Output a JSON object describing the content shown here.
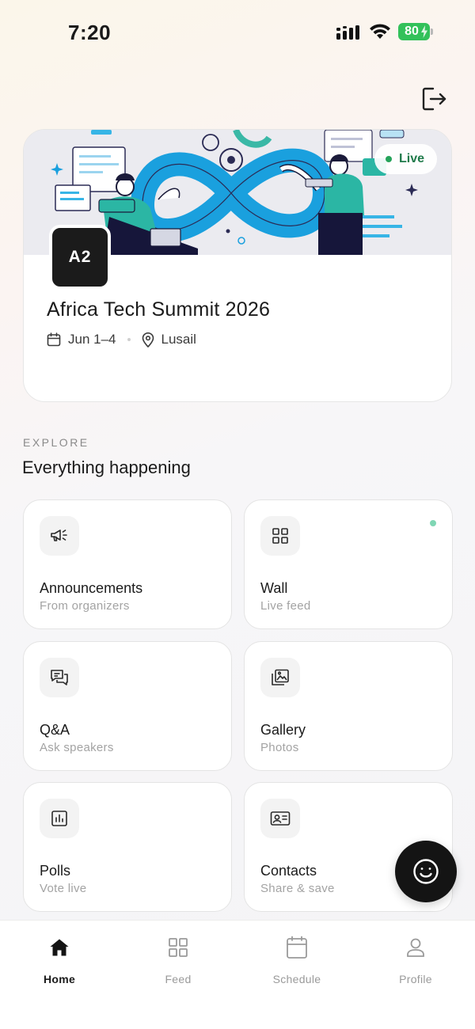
{
  "status_bar": {
    "time": "7:20",
    "battery": "80"
  },
  "header": {
    "logout_icon": "logout-icon"
  },
  "event": {
    "live_label": "Live",
    "logo_text": "A2",
    "title": "Africa Tech Summit 2026",
    "dates": "Jun 1–4",
    "location": "Lusail",
    "colors": {
      "live": "#24a35a",
      "logo_bg": "#1b1b1b"
    }
  },
  "explore": {
    "label": "EXPLORE",
    "title": "Everything happening",
    "tiles": [
      {
        "title": "Announcements",
        "subtitle": "From organizers",
        "icon": "megaphone-icon"
      },
      {
        "title": "Wall",
        "subtitle": "Live feed",
        "icon": "grid-icon",
        "has_update": true
      },
      {
        "title": "Q&A",
        "subtitle": "Ask speakers",
        "icon": "chat-icon"
      },
      {
        "title": "Gallery",
        "subtitle": "Photos",
        "icon": "gallery-icon"
      },
      {
        "title": "Polls",
        "subtitle": "Vote live",
        "icon": "bar-chart-icon"
      },
      {
        "title": "Contacts",
        "subtitle": "Share & save",
        "icon": "contact-card-icon"
      }
    ]
  },
  "fab": {
    "icon": "smiley-icon"
  },
  "nav": {
    "items": [
      {
        "label": "Home",
        "icon": "home-icon",
        "active": true
      },
      {
        "label": "Feed",
        "icon": "grid-icon"
      },
      {
        "label": "Schedule",
        "icon": "calendar-icon"
      },
      {
        "label": "Profile",
        "icon": "user-icon"
      }
    ]
  }
}
